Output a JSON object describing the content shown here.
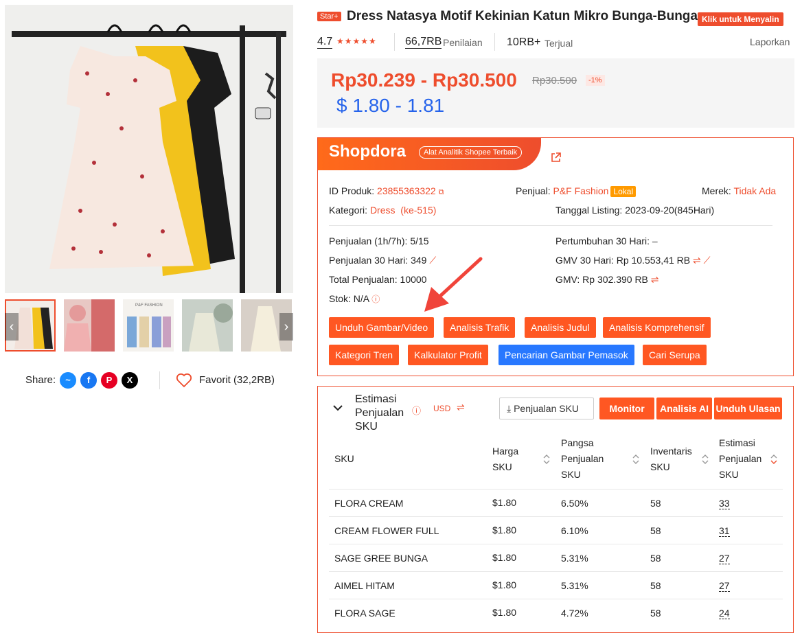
{
  "product": {
    "star_badge": "Star+",
    "title": "Dress Natasya Motif Kekinian Katun Mikro Bunga-Bunga",
    "copy_badge": "Klik untuk Menyalin",
    "rating": "4.7",
    "stars": "★★★★★",
    "reviews_count": "66,7RB",
    "reviews_label": "Penilaian",
    "sold_count": "10RB+",
    "sold_label": "Terjual",
    "report": "Laporkan",
    "price_range": "Rp30.239 - Rp30.500",
    "price_old": "Rp30.500",
    "discount": "-1%",
    "price_usd": "$ 1.80 - 1.81"
  },
  "gallery": {
    "share_label": "Share:",
    "favorite": "Favorit (32,2RB)",
    "thumb_tag": "P&F FASHION"
  },
  "shopdora": {
    "logo": "Shopdora",
    "tagline": "Alat Analitik Shopee Terbaik",
    "product_id_label": "ID Produk:",
    "product_id": "23855363322",
    "seller_label": "Penjual:",
    "seller": "P&F Fashion",
    "seller_badge": "Lokal",
    "brand_label": "Merek:",
    "brand": "Tidak Ada",
    "category_label": "Kategori:",
    "category": "Dress  (ke-515)",
    "listing_label": "Tanggal Listing:",
    "listing": "2023-09-20(845Hari)",
    "sales_1h7h_label": "Penjualan (1h/7h):",
    "sales_1h7h": "5/15",
    "growth_label": "Pertumbuhan 30 Hari:",
    "growth": "–",
    "sales_30_label": "Penjualan 30 Hari:",
    "sales_30": "349",
    "gmv30_label": "GMV 30 Hari:",
    "gmv30": "Rp 10.553,41 RB",
    "total_label": "Total Penjualan:",
    "total": "10000",
    "gmv_label": "GMV:",
    "gmv": "Rp 302.390 RB",
    "stock_label": "Stok:",
    "stock": "N/A",
    "buttons": [
      "Unduh Gambar/Video",
      "Analisis Trafik",
      "Analisis Judul",
      "Analisis Komprehensif",
      "Kategori Tren",
      "Kalkulator Profit",
      "Pencarian Gambar Pemasok",
      "Cari Serupa"
    ]
  },
  "sku": {
    "title": "Estimasi Penjualan SKU",
    "currency": "USD",
    "sales_button": "Penjualan SKU",
    "monitor": "Monitor",
    "ai": "Analisis AI",
    "reviews": "Unduh Ulasan",
    "headers": {
      "sku": "SKU",
      "price": "Harga SKU",
      "share": "Pangsa Penjualan SKU",
      "inventory": "Inventaris SKU",
      "estimate": "Estimasi Penjualan SKU"
    },
    "rows": [
      {
        "name": "FLORA CREAM",
        "price": "$1.80",
        "share": "6.50%",
        "inv": "58",
        "est": "33"
      },
      {
        "name": "CREAM FLOWER FULL",
        "price": "$1.80",
        "share": "6.10%",
        "inv": "58",
        "est": "31"
      },
      {
        "name": "SAGE GREE BUNGA",
        "price": "$1.80",
        "share": "5.31%",
        "inv": "58",
        "est": "27"
      },
      {
        "name": "AIMEL HITAM",
        "price": "$1.80",
        "share": "5.31%",
        "inv": "58",
        "est": "27"
      },
      {
        "name": "FLORA SAGE",
        "price": "$1.80",
        "share": "4.72%",
        "inv": "58",
        "est": "24"
      }
    ]
  },
  "colors": {
    "accent": "#ee4d2d",
    "blue": "#2563eb",
    "button_orange": "#ff5722",
    "button_blue": "#2878ff"
  }
}
